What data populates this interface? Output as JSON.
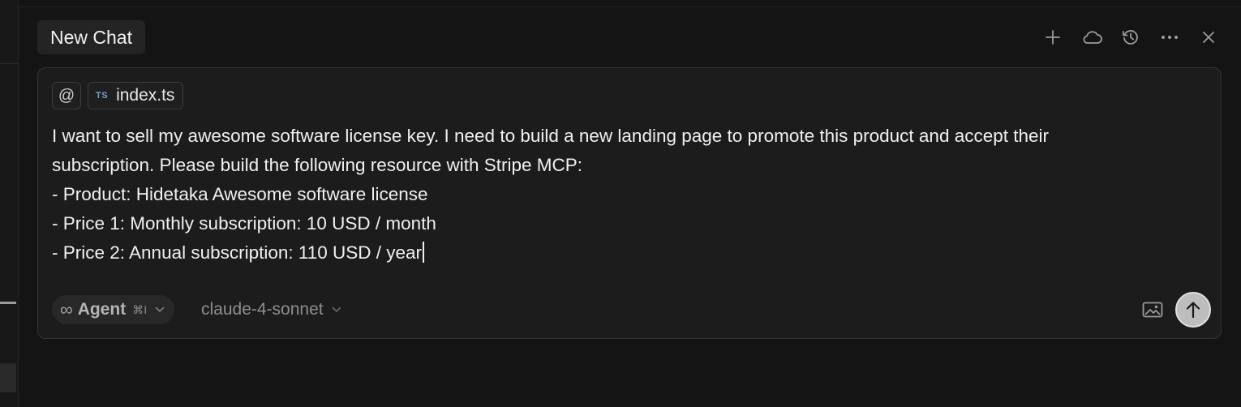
{
  "header": {
    "tab_title": "New Chat",
    "actions": [
      {
        "name": "new-chat",
        "icon": "plus-icon"
      },
      {
        "name": "cloud",
        "icon": "cloud-icon"
      },
      {
        "name": "history",
        "icon": "history-icon"
      },
      {
        "name": "more",
        "icon": "more-icon"
      },
      {
        "name": "close",
        "icon": "close-icon"
      }
    ]
  },
  "composer": {
    "context": {
      "at_symbol": "@",
      "file": {
        "badge": "TS",
        "name": "index.ts"
      }
    },
    "message_lines": [
      "I want to sell my awesome software license key. I need to build a new landing page to promote this product and accept their",
      "subscription. Please build the following resource with Stripe MCP:",
      "- Product: Hidetaka Awesome software license",
      "- Price 1: Monthly subscription: 10 USD / month",
      "- Price 2: Annual subscription: 110 USD / year"
    ],
    "mode": {
      "label": "Agent",
      "shortcut": "⌘I",
      "icon": "infinity-icon"
    },
    "model": {
      "label": "claude-4-sonnet"
    },
    "colors": {
      "background": "#1c1c1c",
      "border": "#343434",
      "send_button": "#bdbdbd"
    }
  }
}
